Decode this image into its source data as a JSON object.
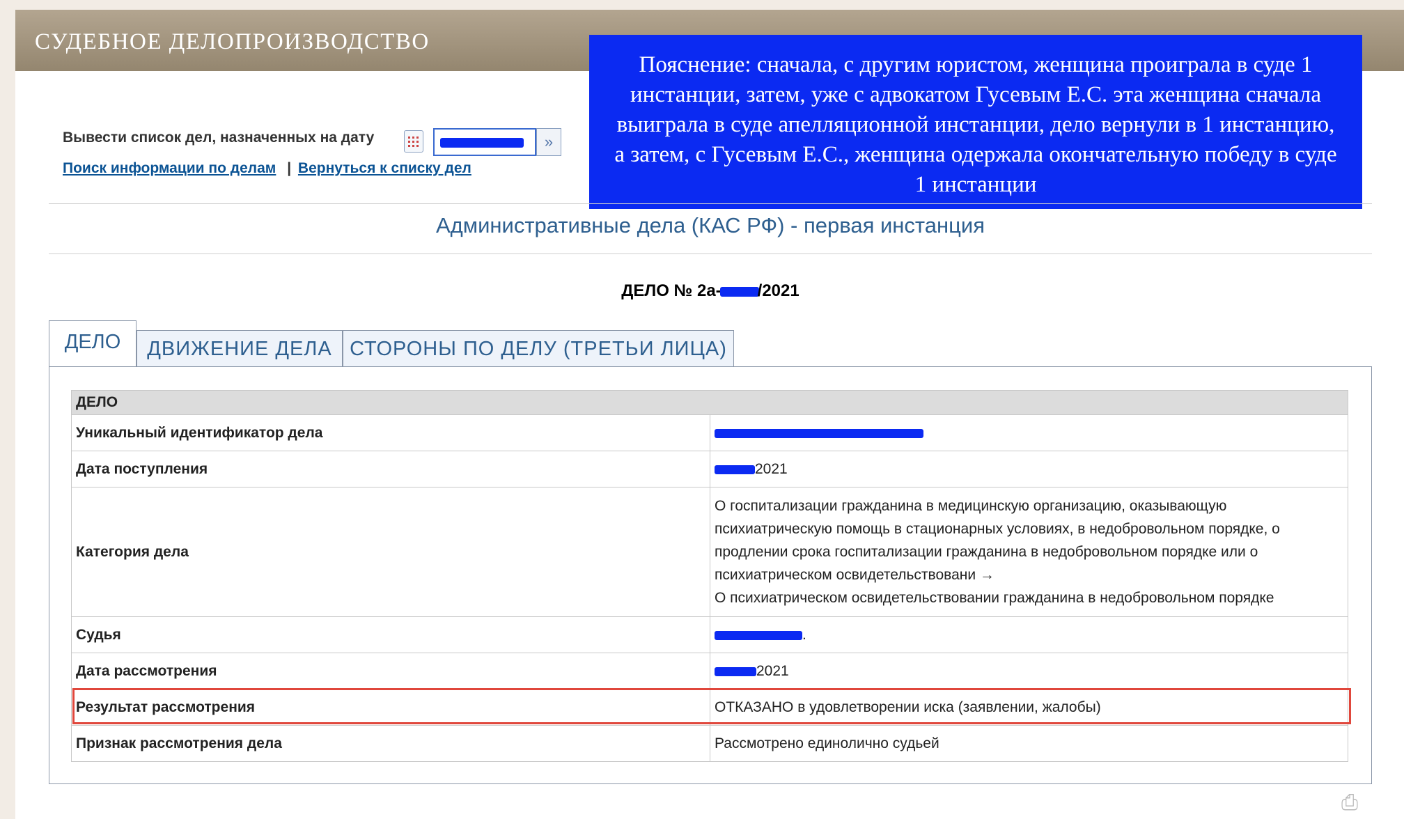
{
  "header": {
    "title": "СУДЕБНОЕ ДЕЛОПРОИЗВОДСТВО"
  },
  "note": {
    "text": "Пояснение: сначала, с другим юристом, женщина проиграла в суде 1 инстанции, затем, уже с адвокатом Гусевым Е.С. эта женщина сначала выиграла в суде апелляционной инстанции, дело вернули в 1 инстанцию, а затем, с Гусевым Е.С., женщина одержала окончательную победу в суде 1 инстанции"
  },
  "datebar": {
    "label": "Вывести список дел, назначенных на дату"
  },
  "links": {
    "search": "Поиск информации по делам",
    "separator": "|",
    "back": "Вернуться к списку дел"
  },
  "page": {
    "instance_title": "Административные дела (КАС РФ) - первая инстанция",
    "case_prefix": "ДЕЛО № 2а-",
    "case_suffix": "/2021"
  },
  "tabs": [
    {
      "label": "ДЕЛО"
    },
    {
      "label": "ДВИЖЕНИЕ ДЕЛА"
    },
    {
      "label": "СТОРОНЫ ПО ДЕЛУ (ТРЕТЬИ ЛИЦА)"
    }
  ],
  "table": {
    "header": "ДЕЛО",
    "rows": {
      "uid_label": "Уникальный идентификатор дела",
      "date_in_label": "Дата поступления",
      "date_in_suffix": "2021",
      "category_label": "Категория дела",
      "category_value_1": "О госпитализации гражданина в медицинскую организацию, оказывающую психиатрическую помощь в стационарных условиях, в недобровольном порядке, о продлении срока госпитализации гражданина в недобровольном порядке или о психиатрическом освидетельствовани →",
      "category_value_2": "О психиатрическом освидетельствовании гражданина в недобровольном порядке",
      "judge_label": "Судья",
      "judge_suffix": ".",
      "hearing_label": "Дата рассмотрения",
      "hearing_suffix": "2021",
      "result_label": "Результат рассмотрения",
      "result_value": "ОТКАЗАНО в удовлетворении иска (заявлении, жалобы)",
      "sign_label": "Признак рассмотрения дела",
      "sign_value": "Рассмотрено единолично судьей"
    }
  },
  "colors": {
    "header_bg": "#a69883",
    "note_bg": "#0b2af2",
    "link": "#0b5394",
    "highlight": "#e0473c"
  },
  "icons": {
    "calendar": "calendar-icon",
    "go": "arrow-right-icon",
    "print": "printer-icon"
  }
}
